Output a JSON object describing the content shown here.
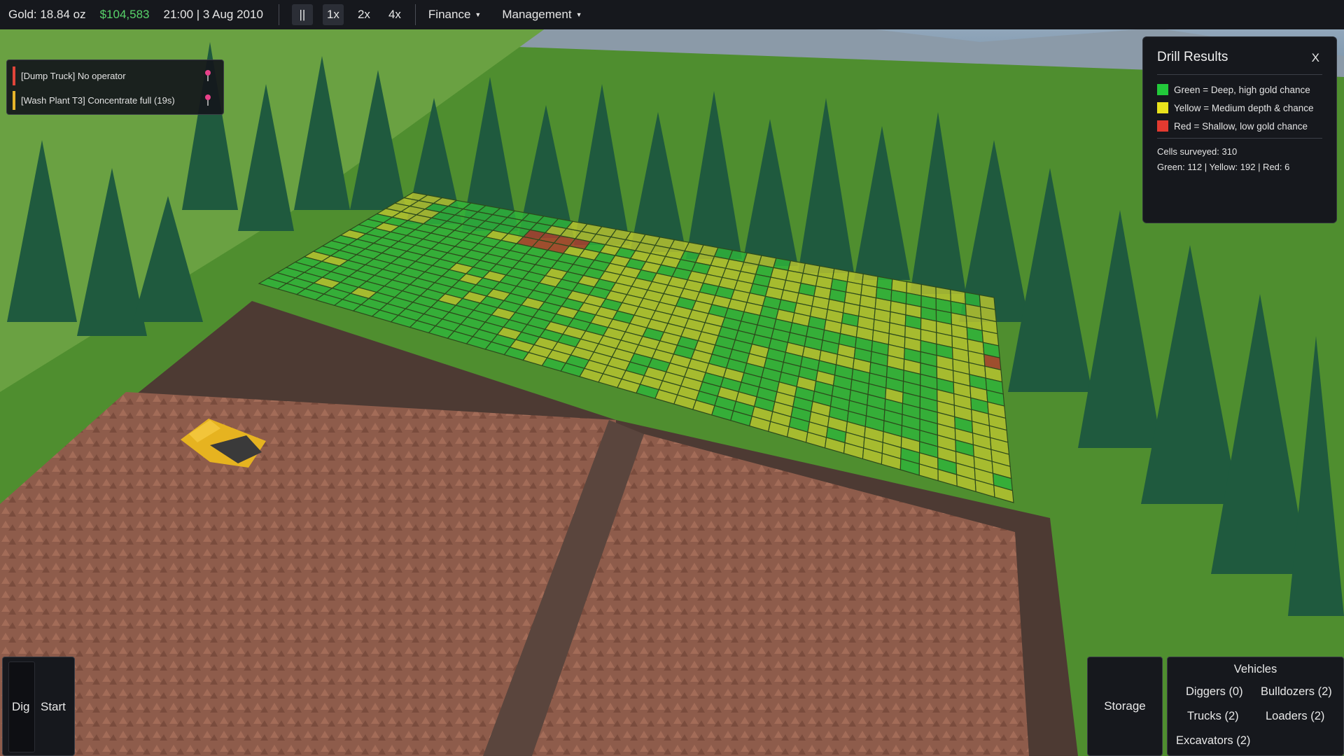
{
  "topbar": {
    "gold": "Gold: 18.84 oz",
    "money": "$104,583",
    "datetime": "21:00 | 3 Aug 2010",
    "pause_label": "||",
    "speeds": [
      "1x",
      "2x",
      "4x"
    ],
    "menus": [
      "Finance",
      "Management"
    ],
    "caret": "▼"
  },
  "alerts": [
    {
      "text": "[Dump Truck] No operator",
      "color": "#e0453a"
    },
    {
      "text": "[Wash Plant T3] Concentrate full (19s)",
      "color": "#e8b52a"
    }
  ],
  "drill": {
    "title": "Drill Results",
    "close": "X",
    "legend": [
      {
        "label": "Green = Deep, high gold chance",
        "color": "#22c93a"
      },
      {
        "label": "Yellow = Medium depth & chance",
        "color": "#e9e21c"
      },
      {
        "label": "Red = Shallow, low gold chance",
        "color": "#e23a30"
      }
    ],
    "cells_surveyed": "Cells surveyed: 310",
    "breakdown": "Green: 112 | Yellow: 192 | Red: 6"
  },
  "bottom_left": {
    "dig": "Dig",
    "start": "Start"
  },
  "storage": "Storage",
  "vehicles": {
    "title": "Vehicles",
    "items": [
      "Diggers (0)",
      "Bulldozers (2)",
      "Trucks (2)",
      "Loaders (2)",
      "Excavators (2)"
    ]
  },
  "colors": {
    "grass": "#4f8e2f",
    "dirt": "#8a5a4a",
    "grid_green": "#2fb53a",
    "grid_yellow": "#b9c430",
    "grid_red": "#b0402e",
    "truck": "#e6b320"
  }
}
